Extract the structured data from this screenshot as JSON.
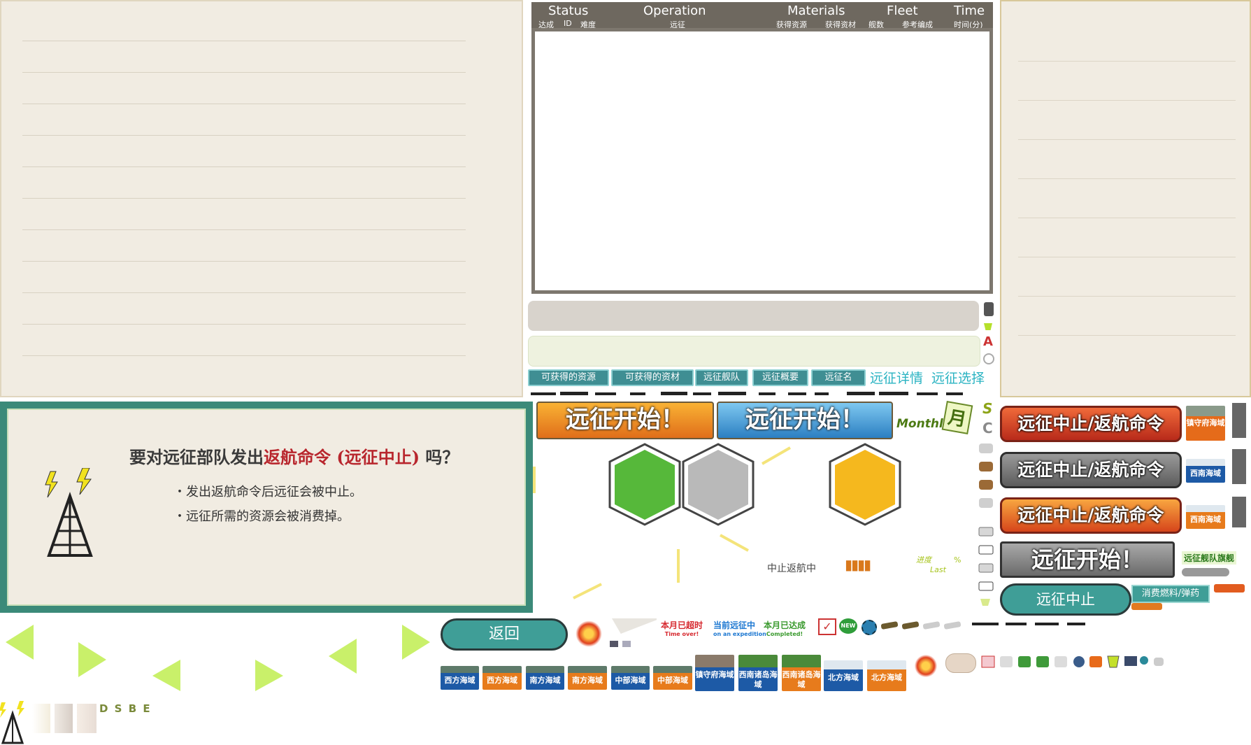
{
  "header": {
    "status": "Status",
    "status_sub": [
      "达成",
      "ID",
      "难度"
    ],
    "operation": "Operation",
    "operation_sub": "远征",
    "materials": "Materials",
    "materials_sub": [
      "获得资源",
      "获得资材"
    ],
    "fleet": "Fleet",
    "fleet_sub": [
      "舰数",
      "参考编成"
    ],
    "time": "Time",
    "time_sub": "时间(分)"
  },
  "tabs": [
    "可获得的资源",
    "可获得的资材",
    "远征舰队",
    "远征概要",
    "远征名"
  ],
  "tab_links": [
    "远征详情",
    "远征选择"
  ],
  "start_buttons": [
    "远征开始！",
    "远征开始！"
  ],
  "monthly": {
    "label": "Monthly",
    "kanji": "月"
  },
  "side_letters": [
    "S",
    "C"
  ],
  "dialog": {
    "title_prefix": "要对远征部队发出",
    "title_highlight": "返航命令 (远征中止)",
    "title_suffix": " 吗？",
    "lines": [
      "・发出返航命令后远征会被中止。",
      "・远征所需的资源会被消费掉。"
    ]
  },
  "status_text": {
    "returning": "中止返航中",
    "progress_label": "进度",
    "last_label": "Last",
    "percent": "%"
  },
  "recall_buttons": [
    "远征中止/返航命令",
    "远征中止/返航命令",
    "远征中止/返航命令"
  ],
  "start_disabled": "远征开始！",
  "stop_button": "远征中止",
  "consume_label": "消费燃料/弹药",
  "flagship_label": "远征舰队旗舰",
  "right_sea_tags": [
    "镇守府海域",
    "西南海域",
    "西南海域"
  ],
  "back_button": "返回",
  "badges": {
    "timeover": "本月已超时",
    "timeover_sub": "Time over!",
    "expedition": "当前远征中",
    "expedition_sub": "on an expedition",
    "completed": "本月已达成",
    "completed_sub": "Completed!",
    "new": "NEW"
  },
  "sea_tags": [
    "西方海域",
    "西方海域",
    "南方海域",
    "南方海域",
    "中部海域",
    "中部海域",
    "镇守府海域",
    "西南诸岛海域",
    "西南诸岛海域",
    "北方海域",
    "北方海域"
  ],
  "rank_letters": "D S B E",
  "letter_a": "A",
  "colors": {
    "teal": "#3f8e93",
    "dialog_border": "#3b8a79",
    "red_highlight": "#b8262d",
    "hex_green": "#56b83a",
    "hex_gray": "#b9b9b9",
    "hex_orange": "#f5b81e",
    "arrow_green": "#c9f06a"
  }
}
